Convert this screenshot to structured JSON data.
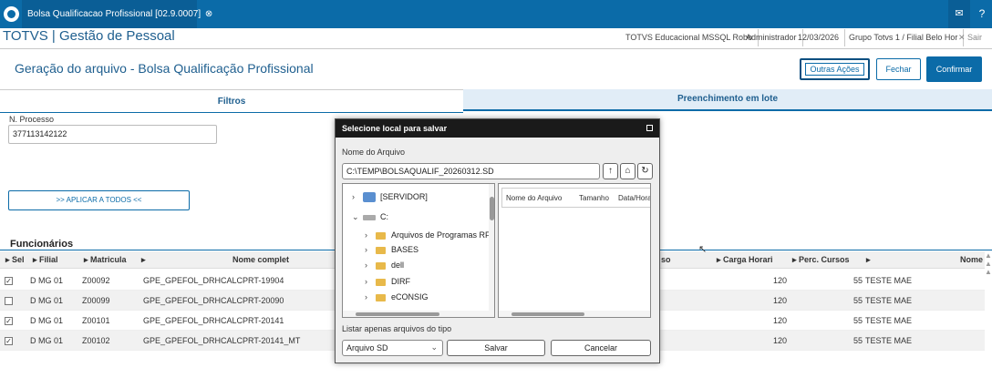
{
  "window": {
    "tab_title": "Bolsa Qualificacao Profissional [02.9.0007]",
    "close_glyph": "⊗",
    "mail_glyph": "✉",
    "help_glyph": "?"
  },
  "header": {
    "brand": "TOTVS | Gestão de Pessoal",
    "environment": "TOTVS Educacional MSSQL Robo",
    "user": "Administrador",
    "date": "12/03/2026",
    "branch": "Grupo Totvs 1 / Filial Belo Hor",
    "exit_label": "✕ Sair"
  },
  "page": {
    "title": "Geração do arquivo - Bolsa Qualificação Profissional",
    "other_actions": "Outras Ações",
    "close": "Fechar",
    "confirm": "Confirmar"
  },
  "tabs": {
    "filters": "Filtros",
    "batch_fill": "Preenchimento em lote"
  },
  "filters": {
    "process_label": "N. Processo",
    "process_value": "377113142122",
    "apply_all": ">> APLICAR A TODOS <<"
  },
  "employees": {
    "title": "Funcionários",
    "columns": [
      "Sel",
      "Filial",
      "Matricula",
      "Nome complet",
      "Carga Horari",
      "Perc. Cursos",
      "Nome"
    ],
    "rows": [
      {
        "checked": true,
        "filial": "D MG 01",
        "matricula": "Z00092",
        "nome": "GPE_GPEFOL_DRHCALCPRT-19904",
        "carga": "120",
        "perc": "55",
        "nome2": "TESTE MAE"
      },
      {
        "checked": false,
        "filial": "D MG 01",
        "matricula": "Z00099",
        "nome": "GPE_GPEFOL_DRHCALCPRT-20090",
        "carga": "120",
        "perc": "55",
        "nome2": "TESTE MAE"
      },
      {
        "checked": true,
        "filial": "D MG 01",
        "matricula": "Z00101",
        "nome": "GPE_GPEFOL_DRHCALCPRT-20141",
        "carga": "120",
        "perc": "55",
        "nome2": "TESTE MAE"
      },
      {
        "checked": true,
        "filial": "D MG 01",
        "matricula": "Z00102",
        "nome": "GPE_GPEFOL_DRHCALCPRT-20141_MT",
        "carga": "120",
        "perc": "55",
        "nome2": "TESTE MAE"
      }
    ],
    "partial_col": "so"
  },
  "dialog": {
    "title": "Selecione local para salvar",
    "filename_label": "Nome do Arquivo",
    "path": "C:\\TEMP\\BOLSAQUALIF_20260312.SD",
    "tree": [
      "[SERVIDOR]",
      "C:",
      "Arquivos de Programas RF",
      "BASES",
      "dell",
      "DIRF",
      "eCONSIG"
    ],
    "file_columns": [
      "Nome do Arquivo",
      "Tamanho",
      "Data/Hora"
    ],
    "file_type_label": "Listar apenas arquivos do tipo",
    "file_type": "Arquivo SD",
    "save": "Salvar",
    "cancel": "Cancelar"
  },
  "colors": {
    "primary": "#0b6ba8",
    "dark": "#1a1a1a"
  }
}
